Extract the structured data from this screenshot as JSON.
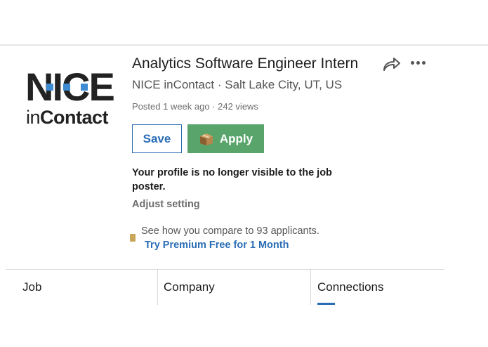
{
  "company_logo": {
    "word1": "NICE",
    "word2_light": "in",
    "word2_bold": "Contact",
    "accent_color": "#3d8bd2"
  },
  "job": {
    "title": "Analytics Software Engineer Intern",
    "company_location": "NICE inContact · Salt Lake City, UT, US",
    "posted_meta": "Posted 1 week ago · 242 views"
  },
  "actions": {
    "share_icon": "share-arrow-icon",
    "more_icon": "more-horizontal-icon",
    "save_label": "Save",
    "apply_label": "Apply",
    "apply_icon": "package-box-icon",
    "save_color": "#2a6db5",
    "apply_color": "#58a46a"
  },
  "profile_notice": {
    "text": "Your profile is no longer visible to the job poster.",
    "adjust_link": "Adjust setting"
  },
  "premium": {
    "icon": "premium-badge-icon",
    "compare_text": "See how you compare to 93 applicants.",
    "cta_link": "Try Premium Free for 1 Month"
  },
  "tabs": [
    {
      "label": "Job",
      "active": false
    },
    {
      "label": "Company",
      "active": false
    },
    {
      "label": "Connections",
      "active": true
    }
  ]
}
